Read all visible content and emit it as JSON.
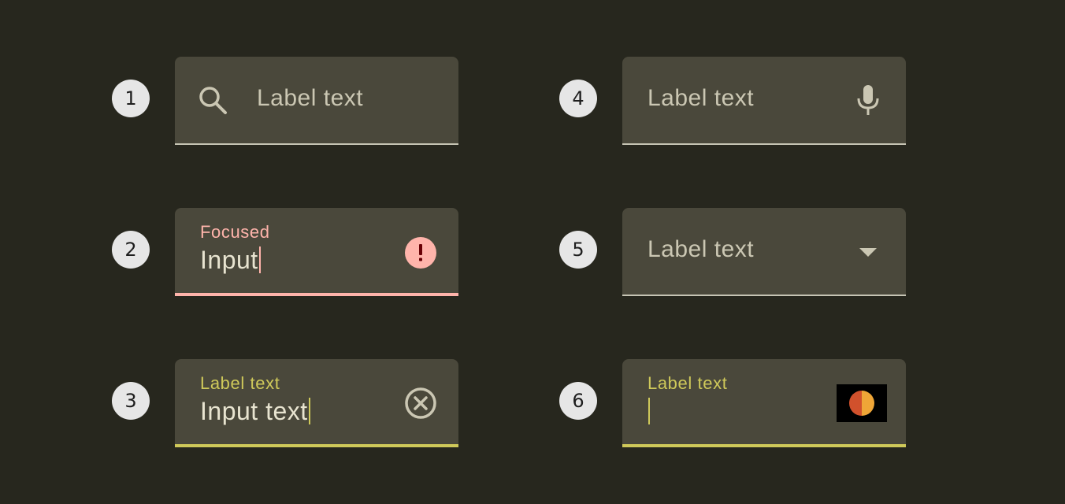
{
  "fields": [
    {
      "number": "1",
      "label": "Label text",
      "leading_icon": "search-icon"
    },
    {
      "number": "2",
      "label": "Focused",
      "value": "Input",
      "trailing_icon": "error-icon",
      "state": "error"
    },
    {
      "number": "3",
      "label": "Label text",
      "value": "Input text",
      "trailing_icon": "clear-icon",
      "state": "focused"
    },
    {
      "number": "4",
      "label": "Label text",
      "trailing_icon": "microphone-icon"
    },
    {
      "number": "5",
      "label": "Label text",
      "trailing_icon": "dropdown-arrow-icon"
    },
    {
      "number": "6",
      "label": "Label text",
      "value": "",
      "trailing_icon": "card-brand-icon",
      "state": "focused"
    }
  ],
  "colors": {
    "background": "#27271e",
    "field_fill": "#4a483b",
    "error": "#ffb4ab",
    "active": "#cfc95a",
    "text": "#e8e4d0",
    "muted": "#cbc7b3",
    "badge": "#e6e6e6",
    "card_left": "#d1512c",
    "card_right": "#efa637"
  }
}
